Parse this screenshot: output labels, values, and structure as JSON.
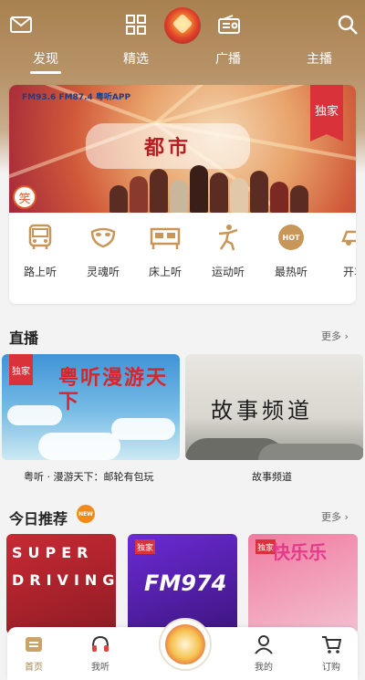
{
  "icons": {
    "mail": "mail-icon",
    "grid": "grid-icon",
    "logo": "app-logo",
    "radio": "radio-icon",
    "search": "search-icon"
  },
  "tabs": [
    "发现",
    "精选",
    "广播",
    "主播"
  ],
  "active_tab": 0,
  "banner": {
    "title": "都市",
    "badge": "独家",
    "logos": "FM93.6  FM87.4  粤听APP",
    "seal": "笑"
  },
  "categories": [
    {
      "label": "路上听",
      "icon": "bus-icon"
    },
    {
      "label": "灵魂听",
      "icon": "mask-icon"
    },
    {
      "label": "床上听",
      "icon": "bed-icon"
    },
    {
      "label": "运动听",
      "icon": "runner-icon"
    },
    {
      "label": "最热听",
      "icon": "hot-icon",
      "icon_text": "HOT"
    },
    {
      "label": "开车",
      "icon": "car-icon"
    }
  ],
  "live": {
    "title": "直播",
    "more": "更多 ›",
    "items": [
      {
        "caption": "粤听 · 漫游天下：邮轮有包玩",
        "badge": "独家",
        "art_text": "粤听漫游天下"
      },
      {
        "caption": "故事频道",
        "art_text": "故事频道"
      }
    ]
  },
  "recommend": {
    "title": "今日推荐",
    "hot_badge": "NEW",
    "more": "更多 ›",
    "items": [
      {
        "art_text": "SUPER DRIVING"
      },
      {
        "art_text": "FM974",
        "badge": "独家"
      },
      {
        "art_text": "快乐乐",
        "badge": "独家"
      }
    ]
  },
  "bottom_nav": [
    {
      "label": "首页",
      "icon": "home-icon",
      "active": true
    },
    {
      "label": "我听",
      "icon": "headphones-icon",
      "active": false
    },
    {
      "label": "",
      "icon": "center-play-icon",
      "active": false
    },
    {
      "label": "我的",
      "icon": "user-icon",
      "active": false
    },
    {
      "label": "订购",
      "icon": "cart-icon",
      "active": false
    }
  ],
  "colors": {
    "header": "#a8814f",
    "accent": "#a98550",
    "badge_red": "#d9323a",
    "hot_orange": "#f28a1a"
  }
}
